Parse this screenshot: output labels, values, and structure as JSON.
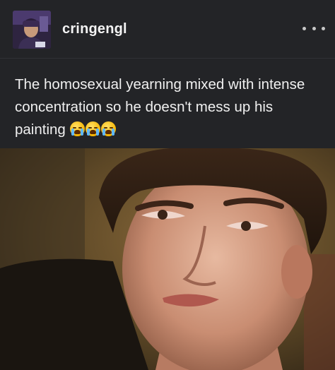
{
  "post": {
    "username": "cringengl",
    "caption": "The homosexual yearning mixed with intense concentration so he doesn't mess up his painting",
    "emojis": "😭😭😭",
    "avatar_icon": "user-avatar-icon",
    "more_icon": "ellipsis-icon"
  },
  "colors": {
    "background": "#232427",
    "text": "#f0f0f0"
  }
}
